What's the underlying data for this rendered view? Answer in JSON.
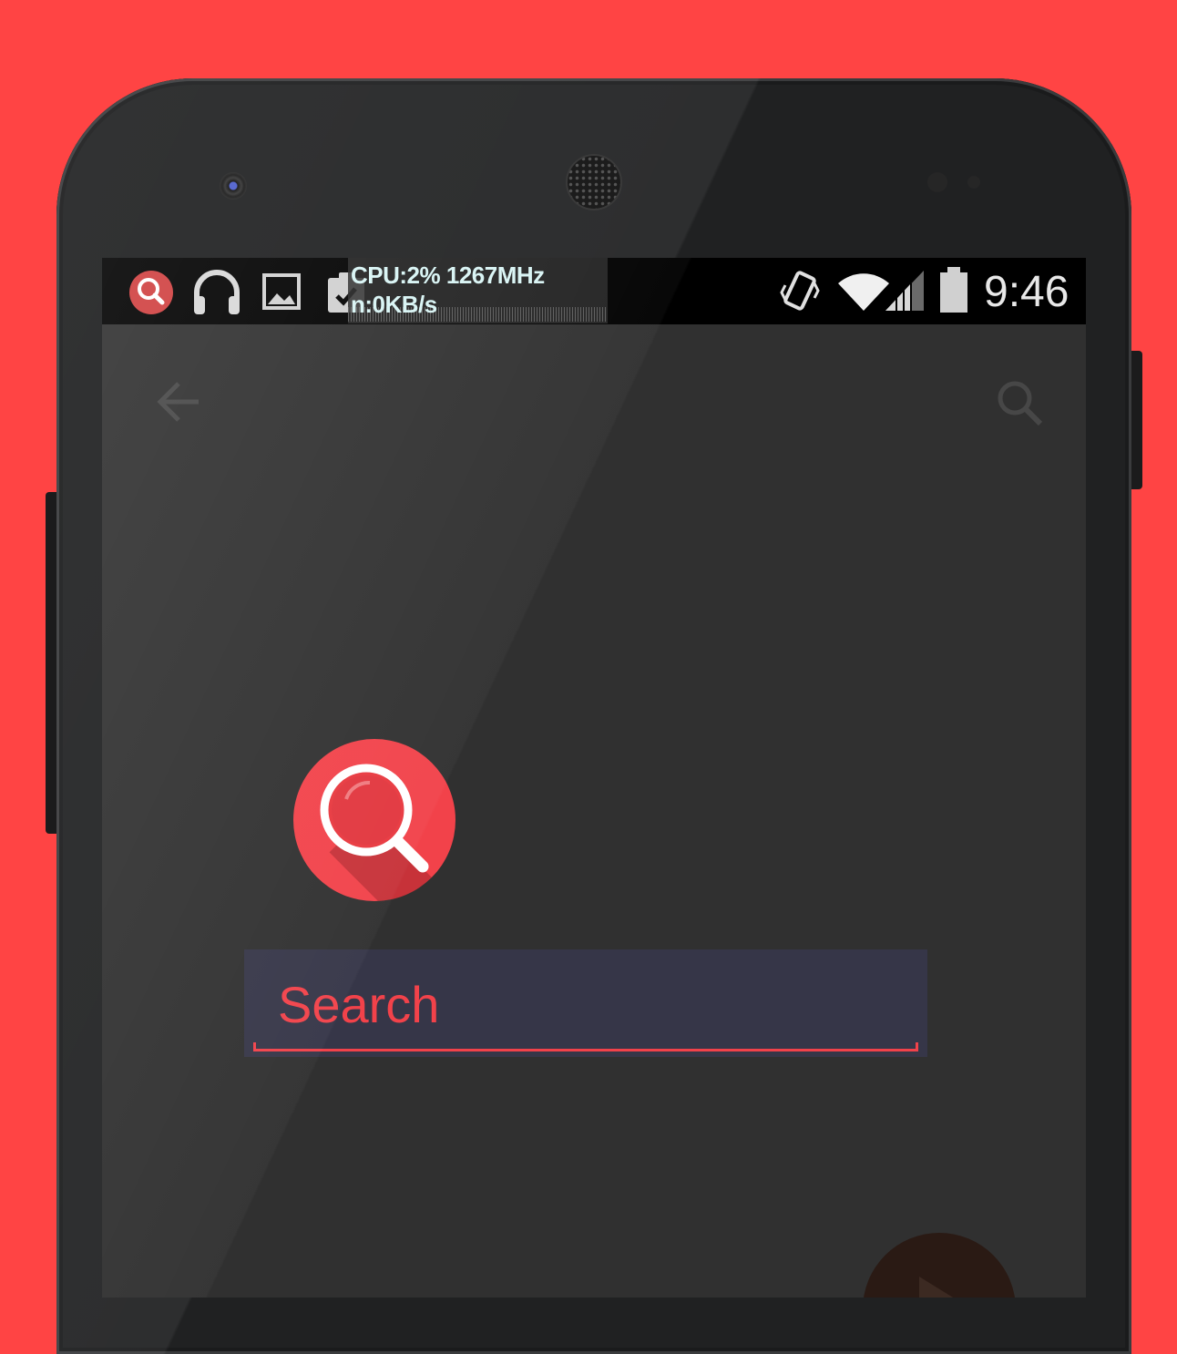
{
  "colors": {
    "background": "#ff4444",
    "accent": "#f2424a",
    "screen": "#303030",
    "search_box": "#363648"
  },
  "status_bar": {
    "notification_icons": [
      "search-icon",
      "headphones-icon",
      "image-icon",
      "clipboard-check-icon"
    ],
    "cpu_text": "CPU:2% 1267MHz",
    "net_text": "n:0KB/s",
    "system_icons": [
      "vibrate-icon",
      "wifi-icon",
      "signal-icon",
      "battery-icon"
    ],
    "time": "9:46"
  },
  "toolbar": {
    "back_icon": "arrow-back-icon",
    "search_icon": "search-icon"
  },
  "main": {
    "logo_icon": "magnifier-logo-icon",
    "search_placeholder": "Search",
    "fab_icon": "play-icon"
  }
}
